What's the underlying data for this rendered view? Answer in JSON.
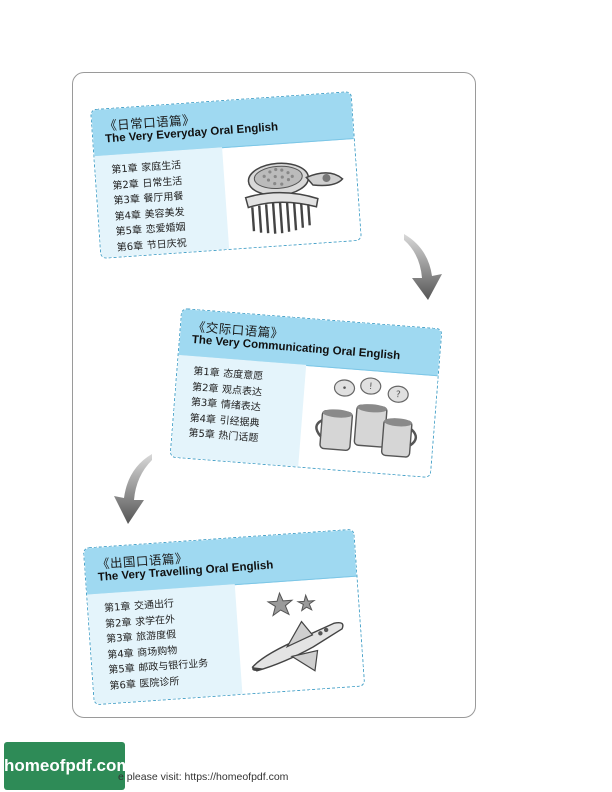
{
  "cards": [
    {
      "title_cn": "《日常口语篇》",
      "title_en": "The Very Everyday Oral English",
      "chapters": [
        {
          "num": "第1章",
          "name": "家庭生活"
        },
        {
          "num": "第2章",
          "name": "日常生活"
        },
        {
          "num": "第3章",
          "name": "餐厅用餐"
        },
        {
          "num": "第4章",
          "name": "美容美发"
        },
        {
          "num": "第5章",
          "name": "恋爱婚姻"
        },
        {
          "num": "第6章",
          "name": "节日庆祝"
        }
      ],
      "illustration": "comb-and-hairbrush-icon"
    },
    {
      "title_cn": "《交际口语篇》",
      "title_en": "The Very Communicating Oral English",
      "chapters": [
        {
          "num": "第1章",
          "name": "态度意愿"
        },
        {
          "num": "第2章",
          "name": "观点表达"
        },
        {
          "num": "第3章",
          "name": "情绪表达"
        },
        {
          "num": "第4章",
          "name": "引经据典"
        },
        {
          "num": "第5章",
          "name": "热门话题"
        }
      ],
      "illustration": "coffee-cups-with-speech-bubbles-icon"
    },
    {
      "title_cn": "《出国口语篇》",
      "title_en": "The Very Travelling Oral English",
      "chapters": [
        {
          "num": "第1章",
          "name": "交通出行"
        },
        {
          "num": "第2章",
          "name": "求学在外"
        },
        {
          "num": "第3章",
          "name": "旅游度假"
        },
        {
          "num": "第4章",
          "name": "商场购物"
        },
        {
          "num": "第5章",
          "name": "邮政与银行业务"
        },
        {
          "num": "第6章",
          "name": "医院诊所"
        }
      ],
      "illustration": "space-shuttle-with-stars-icon"
    }
  ],
  "footer": {
    "badge_text": "homeofpdf.com",
    "note": "e please visit: https://homeofpdf.com"
  },
  "colors": {
    "header_blue": "#9fd9f1",
    "list_blue": "#e4f4fb",
    "dashed_border": "#4aa3c9",
    "badge_green": "#2e8b57"
  }
}
